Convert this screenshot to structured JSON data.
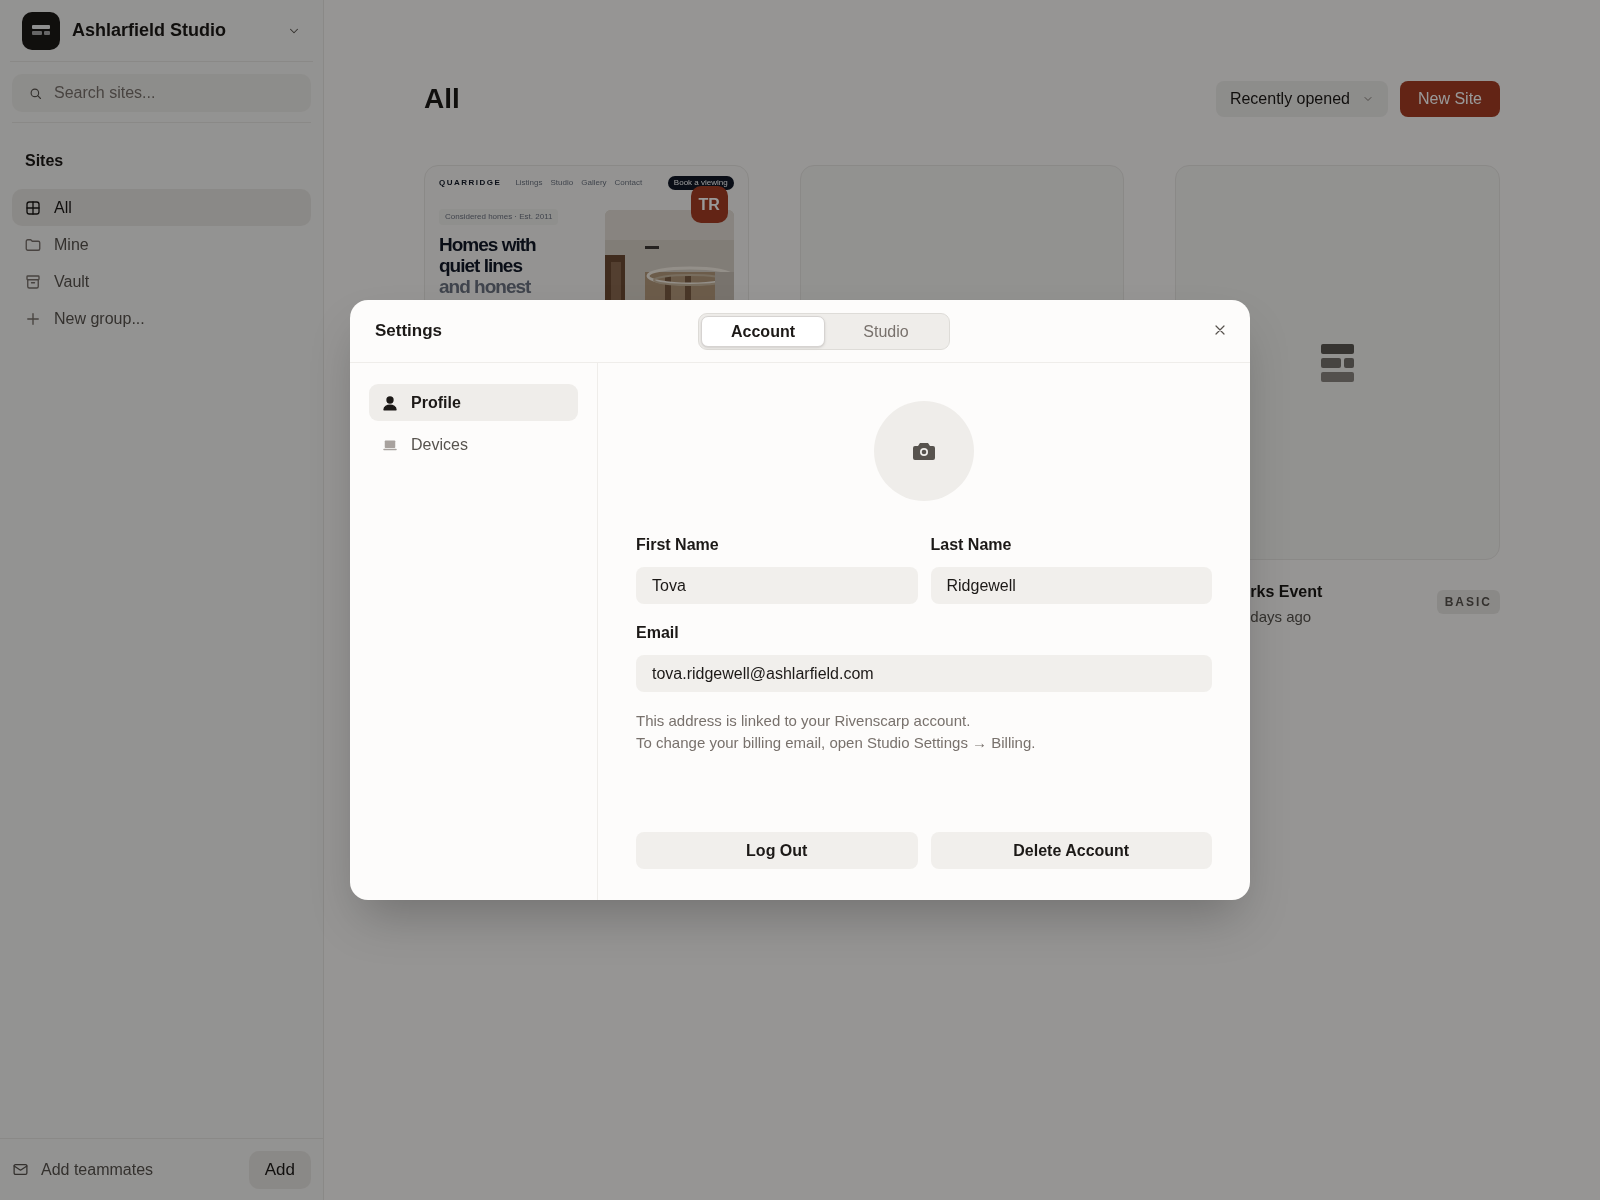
{
  "sidebar": {
    "workspace": "Ashlarfield Studio",
    "search": {
      "placeholder": "Search sites..."
    },
    "section_title": "Sites",
    "items": [
      {
        "label": "All",
        "kind": "grid",
        "selected": true
      },
      {
        "label": "Mine",
        "kind": "folder",
        "selected": false
      },
      {
        "label": "Vault",
        "kind": "archive",
        "selected": false
      },
      {
        "label": "New group...",
        "kind": "plus",
        "selected": false
      }
    ],
    "footer": {
      "label": "Add teammates",
      "button": "Add"
    }
  },
  "main": {
    "title": "All",
    "sort": "Recently opened",
    "new_button": "New Site",
    "sites": [
      {
        "kind": "preview",
        "brand": "QUARRIDGE",
        "nav": [
          "Listings",
          "Studio",
          "Gallery",
          "Contact"
        ],
        "cta": "Book a viewing",
        "tagline": "Considered homes · Est. 2011",
        "headline": "Homes with quiet lines",
        "headline_muted": "and honest",
        "owner": "TR"
      },
      {
        "kind": "blank"
      },
      {
        "kind": "placeholder",
        "name": "rks Event",
        "time": "days ago",
        "plan": "BASIC"
      }
    ]
  },
  "dialog": {
    "title": "Settings",
    "tabs": [
      {
        "label": "Account",
        "selected": true
      },
      {
        "label": "Studio",
        "selected": false
      }
    ],
    "nav": [
      {
        "label": "Profile",
        "kind": "person",
        "selected": true
      },
      {
        "label": "Devices",
        "kind": "laptop",
        "selected": false
      }
    ],
    "fields": [
      {
        "label": "First Name",
        "value": "Tova"
      },
      {
        "label": "Last Name",
        "value": "Ridgewell"
      },
      {
        "label": "Email",
        "value": "tova.ridgewell@ashlarfield.com"
      }
    ],
    "help": [
      "This address is linked to your Rivenscarp account.",
      "To change your billing email, open Studio Settings → Billing."
    ],
    "buttons": [
      "Log Out",
      "Delete Account"
    ]
  }
}
